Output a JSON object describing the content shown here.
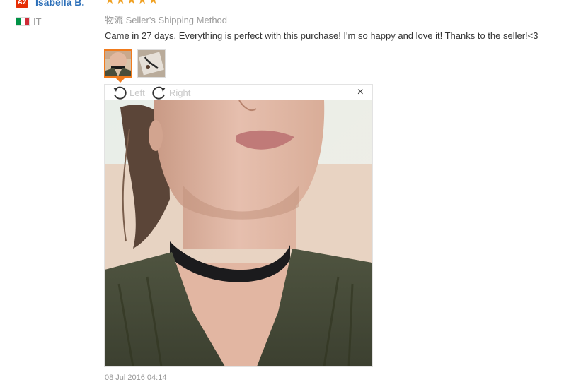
{
  "reviewer": {
    "level_badge": "A2",
    "name": "Isabella B.",
    "country_code": "IT",
    "flag_colors": [
      "#009246",
      "#ffffff",
      "#ce2b37"
    ]
  },
  "review": {
    "rating": 5,
    "stars": [
      "★",
      "★",
      "★",
      "★",
      "★"
    ],
    "star_color": "#f0a020",
    "shipping_method": "物流 Seller's Shipping Method",
    "text": "Came in 27 days. Everything is perfect with this purchase! I'm so happy and love it! Thanks to the seller!<3",
    "date": "08 Jul 2016 04:14"
  },
  "viewer": {
    "rotate_left_label": "Left",
    "rotate_right_label": "Right",
    "close_symbol": "×",
    "icons": {
      "rotate_left": "rotate-left-icon",
      "rotate_right": "rotate-right-icon",
      "close": "close-icon"
    }
  },
  "colors": {
    "name_link": "#2c6fb8",
    "active_thumb_border": "#f07b1d",
    "muted_text": "#999999"
  }
}
